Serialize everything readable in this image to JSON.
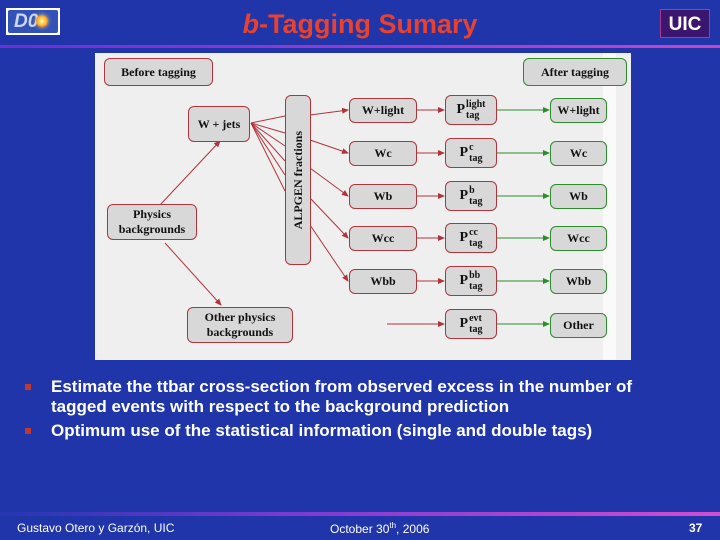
{
  "header": {
    "logo_left": "D0",
    "title_italic": "b",
    "title_rest": "-Tagging Sumary",
    "logo_right": "UIC"
  },
  "diagram": {
    "before_label": "Before tagging",
    "after_label": "After tagging",
    "sources": {
      "wjets": "W + jets",
      "physics": "Physics backgrounds",
      "other_physics": "Other physics backgrounds"
    },
    "fractions_label": "ALPGEN fractions",
    "samples": [
      "W+light",
      "Wc",
      "Wb",
      "Wcc",
      "Wbb"
    ],
    "ptags": [
      {
        "base": "P",
        "sup": "light",
        "sub": "tag"
      },
      {
        "base": "P",
        "sup": "c",
        "sub": "tag"
      },
      {
        "base": "P",
        "sup": "b",
        "sub": "tag"
      },
      {
        "base": "P",
        "sup": "cc",
        "sub": "tag"
      },
      {
        "base": "P",
        "sup": "bb",
        "sub": "tag"
      },
      {
        "base": "P",
        "sup": "evt",
        "sub": "tag"
      }
    ],
    "outputs": [
      "W+light",
      "Wc",
      "Wb",
      "Wcc",
      "Wbb",
      "Other"
    ],
    "colors": {
      "before_stroke": "#b0343c",
      "after_stroke": "#2e8b2e"
    }
  },
  "bullets": [
    "Estimate the ttbar cross-section from observed excess in the number of tagged events with respect to the background prediction",
    "Optimum use of the statistical information (single and double tags)"
  ],
  "footer": {
    "author": "Gustavo Otero y Garzón, UIC",
    "date_pre": "October 30",
    "date_sup": "th",
    "date_post": ", 2006",
    "page": "37"
  }
}
